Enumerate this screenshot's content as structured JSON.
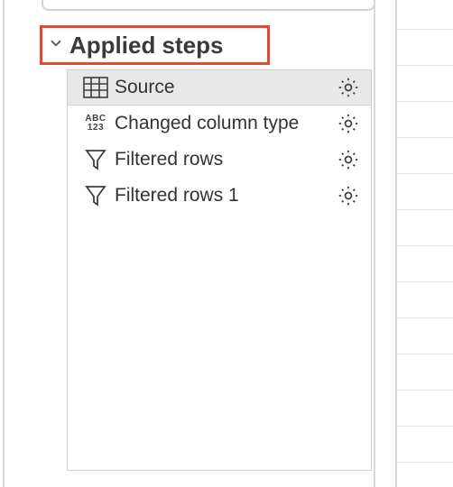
{
  "section": {
    "title": "Applied steps"
  },
  "steps": [
    {
      "label": "Source",
      "icon": "table",
      "selected": true,
      "has_settings": true
    },
    {
      "label": "Changed column type",
      "icon": "abc123",
      "selected": false,
      "has_settings": true
    },
    {
      "label": "Filtered rows",
      "icon": "funnel",
      "selected": false,
      "has_settings": true
    },
    {
      "label": "Filtered rows 1",
      "icon": "funnel",
      "selected": false,
      "has_settings": true
    }
  ]
}
